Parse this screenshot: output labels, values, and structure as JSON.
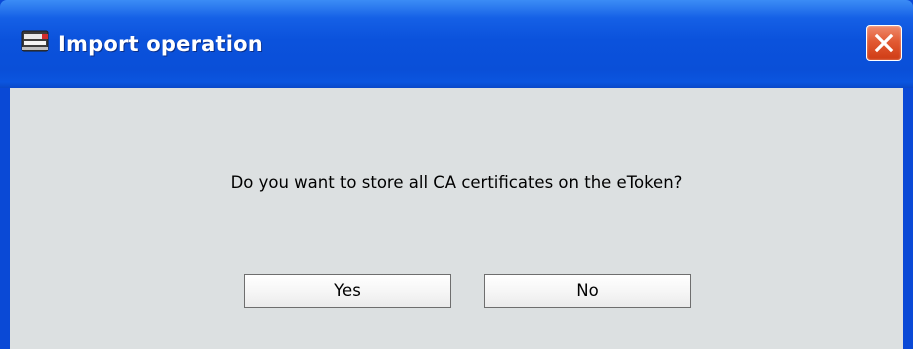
{
  "window": {
    "title": "Import operation",
    "icon": "etoken-icon",
    "close_icon": "close-icon",
    "colors": {
      "titlebar": "#0b52dc",
      "client": "#dce0e1",
      "close_button": "#e25a33"
    }
  },
  "dialog": {
    "message": "Do you want to store all CA certificates on the eToken?",
    "buttons": {
      "yes_label": "Yes",
      "no_label": "No"
    }
  }
}
